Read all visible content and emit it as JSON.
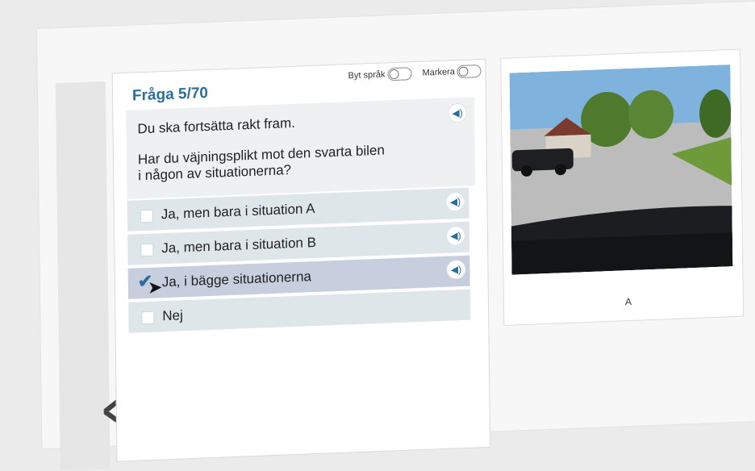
{
  "question": {
    "number": "Fråga 5/70",
    "prompt_line1": "Du ska fortsätta rakt fram.",
    "prompt_line2": "Har du väjningsplikt mot den svarta bilen",
    "prompt_line3": "i någon av situationerna?"
  },
  "toggles": {
    "language_label": "Byt språk",
    "mark_label": "Markera"
  },
  "answers": [
    {
      "label": "Ja, men bara i situation A",
      "checked": false
    },
    {
      "label": "Ja, men bara i situation B",
      "checked": false
    },
    {
      "label": "Ja, i bägge situationerna",
      "checked": true
    },
    {
      "label": "Nej",
      "checked": false
    }
  ],
  "image": {
    "caption": "A"
  },
  "navigation": {
    "back_symbol": "‹"
  },
  "colors": {
    "accent": "#2b6e9e",
    "answer_bg": "#dfe6ea",
    "selected_bg": "#c7cfdf"
  },
  "icons": {
    "audio": "speaker-icon",
    "back": "chevron-left-icon",
    "checkbox": "checkbox-icon",
    "cursor": "cursor-icon"
  }
}
